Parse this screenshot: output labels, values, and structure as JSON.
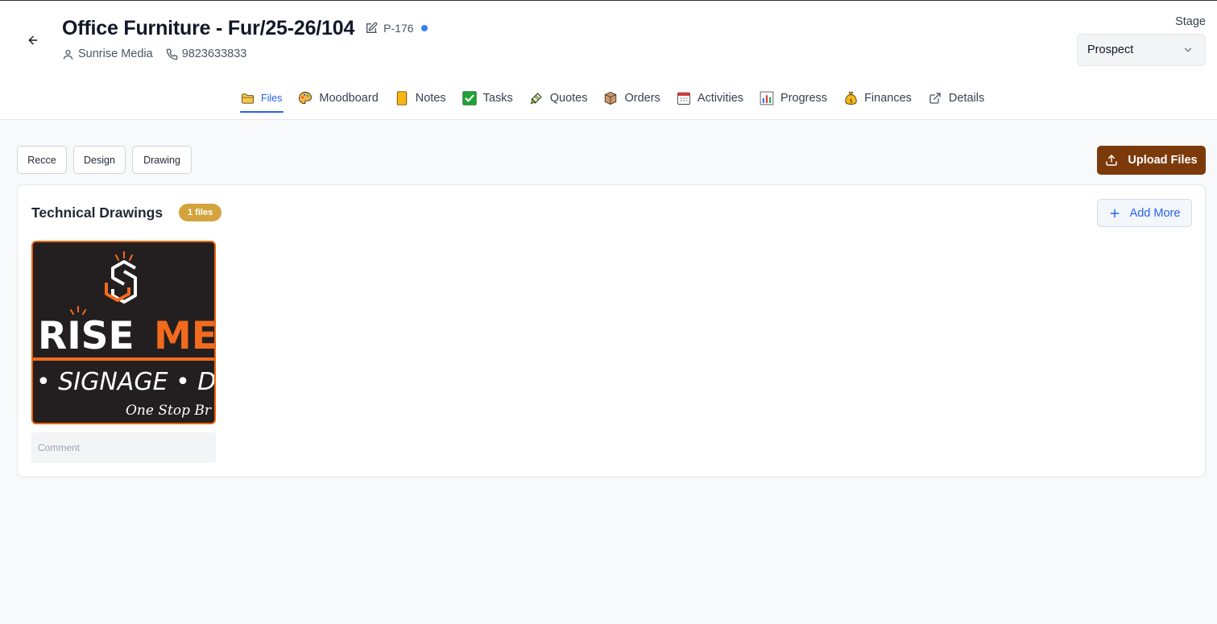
{
  "header": {
    "title": "Office Furniture - Fur/25-26/104",
    "code": "P-176",
    "client_name": "Sunrise Media",
    "phone": "9823633833",
    "stage_label": "Stage",
    "stage_value": "Prospect"
  },
  "tabs": [
    {
      "label": "Files",
      "icon": "folder-icon",
      "active": true
    },
    {
      "label": "Moodboard",
      "icon": "palette-icon"
    },
    {
      "label": "Notes",
      "icon": "note-icon"
    },
    {
      "label": "Tasks",
      "icon": "checkbox-icon"
    },
    {
      "label": "Quotes",
      "icon": "quote-icon"
    },
    {
      "label": "Orders",
      "icon": "package-icon"
    },
    {
      "label": "Activities",
      "icon": "calendar-icon"
    },
    {
      "label": "Progress",
      "icon": "bar-chart-icon"
    },
    {
      "label": "Finances",
      "icon": "money-bag-icon"
    },
    {
      "label": "Details",
      "icon": "external-link-icon"
    }
  ],
  "filters": [
    "Recce",
    "Design",
    "Drawing"
  ],
  "upload_label": "Upload Files",
  "section": {
    "title": "Technical Drawings",
    "badge": "1 files",
    "add_more_label": "Add More"
  },
  "file": {
    "logo_line1_white": "RISE ",
    "logo_line1_orange": "ME",
    "logo_line2": "• SIGNAGE • D",
    "logo_line3": "One Stop Br",
    "comment_placeholder": "Comment"
  },
  "colors": {
    "accent_blue": "#2563eb",
    "upload_brown": "#7c3a0b",
    "badge_gold": "#d4a33d",
    "logo_orange": "#f26b1d",
    "logo_bg": "#231f20"
  }
}
